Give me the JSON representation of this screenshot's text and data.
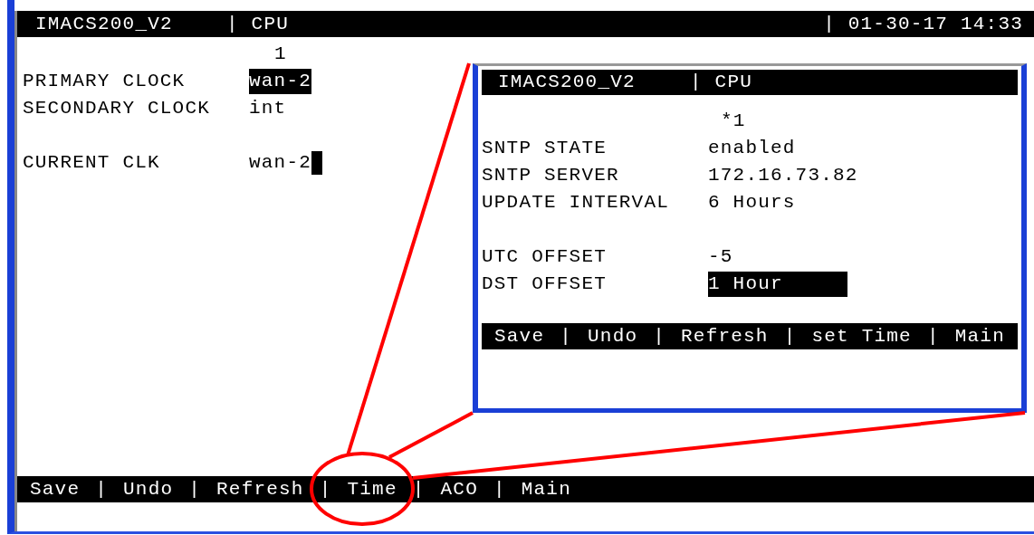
{
  "terminal": {
    "header": {
      "title": "IMACS200_V2",
      "module": "| CPU",
      "datetime": "| 01-30-17 14:33"
    },
    "column_header": "1",
    "field_groups": [
      [
        {
          "label": "PRIMARY CLOCK",
          "value": "wan-2",
          "selected": true,
          "cursor": false
        },
        {
          "label": "SECONDARY CLOCK",
          "value": "int",
          "selected": false,
          "cursor": false
        }
      ],
      [
        {
          "label": "CURRENT CLK",
          "value": "wan-2",
          "selected": false,
          "cursor": true
        }
      ]
    ],
    "menu": {
      "separator": "|",
      "items": [
        "Save",
        "Undo",
        "Refresh",
        "Time",
        "ACO",
        "Main"
      ]
    }
  },
  "inset_window": {
    "header": {
      "title": "IMACS200_V2",
      "module": "| CPU"
    },
    "column_header": "*1",
    "field_groups": [
      [
        {
          "label": "SNTP STATE",
          "value": "enabled",
          "selected": false,
          "cursor": false
        },
        {
          "label": "SNTP SERVER",
          "value": "172.16.73.82",
          "selected": false,
          "cursor": false
        },
        {
          "label": "UPDATE INTERVAL",
          "value": "6 Hours",
          "selected": false,
          "cursor": false
        }
      ],
      [
        {
          "label": "UTC OFFSET",
          "value": "-5",
          "selected": false,
          "cursor": false
        },
        {
          "label": "DST OFFSET",
          "value": "1 Hour",
          "selected": true,
          "cursor": false
        }
      ]
    ],
    "menu": {
      "separator": "|",
      "items": [
        "Save",
        "Undo",
        "Refresh",
        "set Time",
        "Main"
      ]
    }
  }
}
